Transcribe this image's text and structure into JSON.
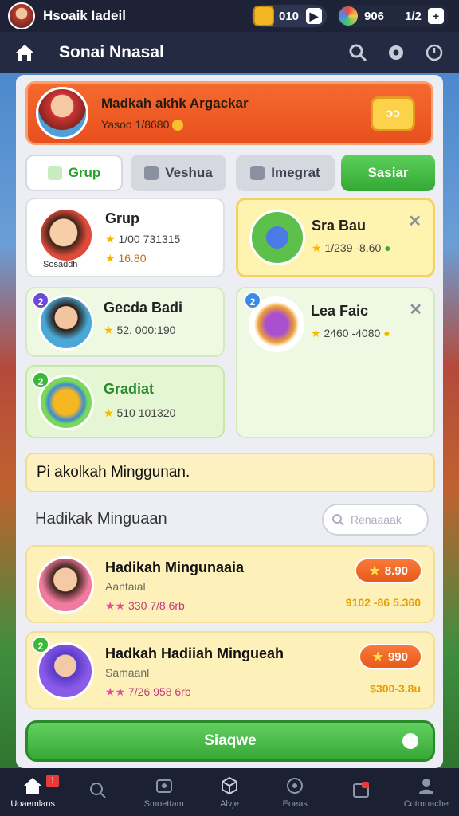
{
  "topbar": {
    "player_name": "Hsoaik Iadeil",
    "coins": "010",
    "gems": "906",
    "extra": "1/2"
  },
  "header": {
    "title": "Sonai Nnasal"
  },
  "banner": {
    "title": "Madkah akhk Argackar",
    "subtitle": "Yasoo 1/8680",
    "badge": "ↄↄ"
  },
  "tabs": [
    {
      "label": "Grup"
    },
    {
      "label": "Veshua"
    },
    {
      "label": "Imegrat"
    },
    {
      "label": "Sasiar"
    }
  ],
  "cards": {
    "grup": {
      "title": "Grup",
      "line1": "1/00 731315",
      "line2": "16.80",
      "caption": "Sosaddh"
    },
    "sra": {
      "title": "Sra Bau",
      "line1": "1/239 -8.60"
    },
    "gecda": {
      "title": "Gecda Badi",
      "line1": "52. 000:190",
      "num": "2"
    },
    "lea": {
      "title": "Lea Faic",
      "line1": "2460 -4080",
      "num": "2"
    },
    "gradiat": {
      "title": "Gradiat",
      "line1": "510 101320",
      "num": "2"
    }
  },
  "notice": {
    "text": "Pi akolkah Minggunan."
  },
  "section": {
    "title": "Hadikak Minguaan",
    "search_placeholder": "Renaaaak"
  },
  "rewards": [
    {
      "name": "Hadikah Mingunaaia",
      "sub": "Aantaial",
      "stats": "330  7/8  6rb",
      "button": "8.90",
      "total": "9102 -86  5.360"
    },
    {
      "name": "Hadkah Hadiiah Mingueah",
      "sub": "Samaanl",
      "stats": "7/26  958  6rb",
      "button": "990",
      "total": "$300-3.8u"
    }
  ],
  "main_button": "Siaqwe",
  "nav": [
    {
      "label": "Uoaemlans",
      "badge": "!"
    },
    {
      "label": ""
    },
    {
      "label": "Smoettam"
    },
    {
      "label": "Alvje"
    },
    {
      "label": "Eoeas"
    },
    {
      "label": ""
    },
    {
      "label": "Cotmnache"
    }
  ],
  "colors": {
    "accent_green": "#36a836",
    "accent_orange": "#e8501e",
    "header_bg": "#232a41"
  }
}
